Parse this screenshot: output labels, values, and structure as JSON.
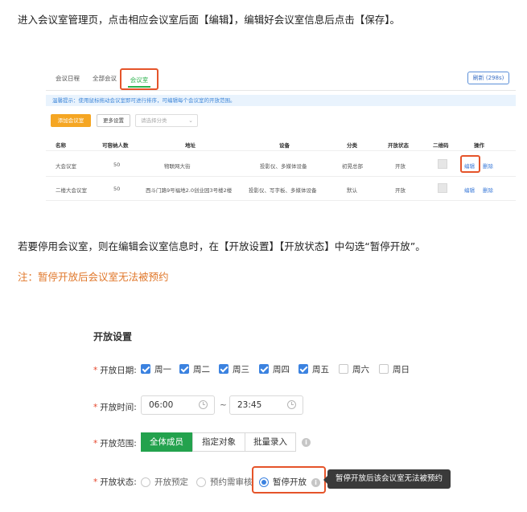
{
  "instructions": {
    "line1": "进入会议室管理页，点击相应会议室后面【编辑】，编辑好会议室信息后点击【保存】。",
    "line2": "若要停用会议室，则在编辑会议室信息时，在【开放设置】【开放状态】中勾选“暂停开放”。",
    "note": "注：暂停开放后会议室无法被预约"
  },
  "panel1": {
    "tabs": [
      "会议日程",
      "全部会议",
      "会议室"
    ],
    "refresh": "刷新 (298s)",
    "tip": "温馨提示：使用鼠标拖动会议室即可进行排序，可编辑每个会议室的开放范围。",
    "toolbar": {
      "add": "添加会议室",
      "more": "更多设置",
      "category_placeholder": "请选择分类"
    },
    "columns": [
      "名称",
      "可容纳人数",
      "地址",
      "设备",
      "分类",
      "开放状态",
      "二维码",
      "操作"
    ],
    "rows": [
      {
        "name": "大会议室",
        "capacity": "50",
        "address": "物联网大街",
        "equipment": "投影仪、多媒体设备",
        "category": "初晃总部",
        "status": "开放",
        "edit": "编辑",
        "delete": "删除"
      },
      {
        "name": "二楼大会议室",
        "capacity": "50",
        "address": "西斗门路9号福地2.0创业园3号楼2楼",
        "equipment": "投影仪、写字板、多媒体设备",
        "category": "默认",
        "status": "开放",
        "edit": "编辑",
        "delete": "删除"
      }
    ]
  },
  "panel2": {
    "title": "开放设置",
    "dates_label": "开放日期:",
    "days": [
      {
        "label": "周一",
        "checked": true
      },
      {
        "label": "周二",
        "checked": true
      },
      {
        "label": "周三",
        "checked": true
      },
      {
        "label": "周四",
        "checked": true
      },
      {
        "label": "周五",
        "checked": true
      },
      {
        "label": "周六",
        "checked": false
      },
      {
        "label": "周日",
        "checked": false
      }
    ],
    "time_label": "开放时间:",
    "start_time": "06:00",
    "tilde": "~",
    "end_time": "23:45",
    "scope_label": "开放范围:",
    "scope_options": [
      "全体成员",
      "指定对象",
      "批量录入"
    ],
    "status_label": "开放状态:",
    "status_options": [
      "开放预定",
      "预约需审核",
      "暂停开放"
    ],
    "tooltip": "暂停开放后该会议室无法被预约",
    "colors": {
      "accent_green": "#23a24d",
      "accent_blue": "#3b82e0",
      "highlight": "#e5542a",
      "note": "#e0772a"
    }
  }
}
